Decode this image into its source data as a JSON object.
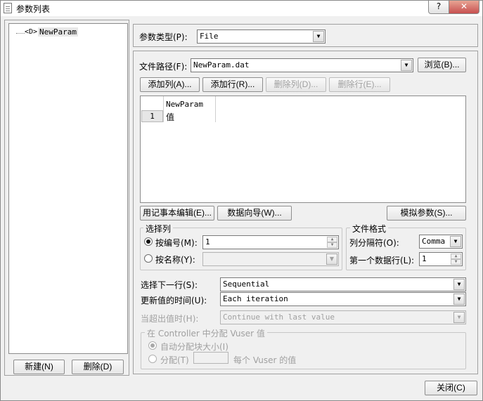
{
  "window": {
    "title": "参数列表",
    "help_label": "?",
    "close_label": "✕"
  },
  "tree": {
    "items": [
      {
        "icon": "<D>",
        "label": "NewParam"
      }
    ]
  },
  "left_buttons": {
    "new_label": "新建(N)",
    "delete_label": "删除(D)"
  },
  "param_type": {
    "label": "参数类型(P):",
    "value": "File"
  },
  "file_path": {
    "label": "文件路径(F):",
    "value": "NewParam.dat",
    "browse_label": "浏览(B)..."
  },
  "table_actions": {
    "add_column": "添加列(A)...",
    "add_row": "添加行(R)...",
    "delete_column": "删除列(D)...",
    "delete_row": "删除行(E)..."
  },
  "grid": {
    "columns": [
      "NewParam"
    ],
    "rows": [
      {
        "num": "1",
        "cells": [
          "值"
        ]
      }
    ]
  },
  "table_tools": {
    "notepad_edit": "用记事本编辑(E)...",
    "data_wizard": "数据向导(W)...",
    "simulate": "模拟参数(S)..."
  },
  "select_column": {
    "title": "选择列",
    "by_number_label": "按编号(M):",
    "by_number_value": "1",
    "by_name_label": "按名称(Y):",
    "by_name_value": ""
  },
  "file_format": {
    "title": "文件格式",
    "delimiter_label": "列分隔符(O):",
    "delimiter_value": "Comma",
    "first_row_label": "第一个数据行(L):",
    "first_row_value": "1"
  },
  "next_row": {
    "label": "选择下一行(S):",
    "value": "Sequential"
  },
  "update_value": {
    "label": "更新值的时间(U):",
    "value": "Each iteration"
  },
  "out_of_values": {
    "label": "当超出值时(H):",
    "value": "Continue with last value"
  },
  "controller": {
    "title": "在 Controller 中分配 Vuser 值",
    "auto_label": "自动分配块大小(I)",
    "allocate_label": "分配(T)",
    "allocate_value": "",
    "per_vuser_label": "每个 Vuser 的值"
  },
  "footer": {
    "close_label": "关闭(C)"
  }
}
